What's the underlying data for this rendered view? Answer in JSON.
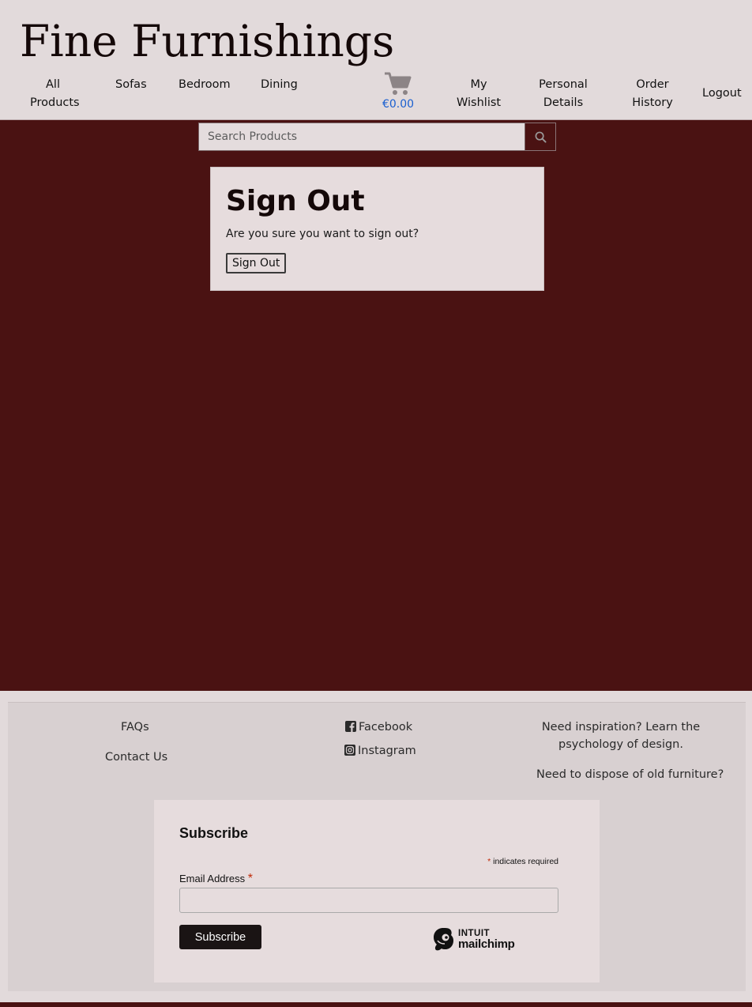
{
  "brand": "Fine Furnishings",
  "nav": {
    "all_products": "All\nProducts",
    "sofas": "Sofas",
    "bedroom": "Bedroom",
    "dining": "Dining",
    "cart_total": "€0.00",
    "wishlist": "My\nWishlist",
    "personal_details": "Personal\nDetails",
    "order_history": "Order\nHistory",
    "logout": "Logout"
  },
  "search": {
    "placeholder": "Search Products"
  },
  "signout": {
    "title": "Sign Out",
    "message": "Are you sure you want to sign out?",
    "button": "Sign Out"
  },
  "footer": {
    "faqs": "FAQs",
    "contact": "Contact Us",
    "facebook": "Facebook",
    "instagram": "Instagram",
    "inspiration": "Need inspiration? Learn the psychology of design.",
    "dispose": "Need to dispose of old furniture?"
  },
  "subscribe": {
    "title": "Subscribe",
    "required_note": "indicates required",
    "asterisk": "*",
    "email_label": "Email Address",
    "button": "Subscribe",
    "logo_line1": "INTUIT",
    "logo_line2": "mailchimp"
  },
  "colors": {
    "header_bg": "#e2dadb",
    "page_bg": "#4a1212",
    "link_blue": "#1a5fd0"
  }
}
